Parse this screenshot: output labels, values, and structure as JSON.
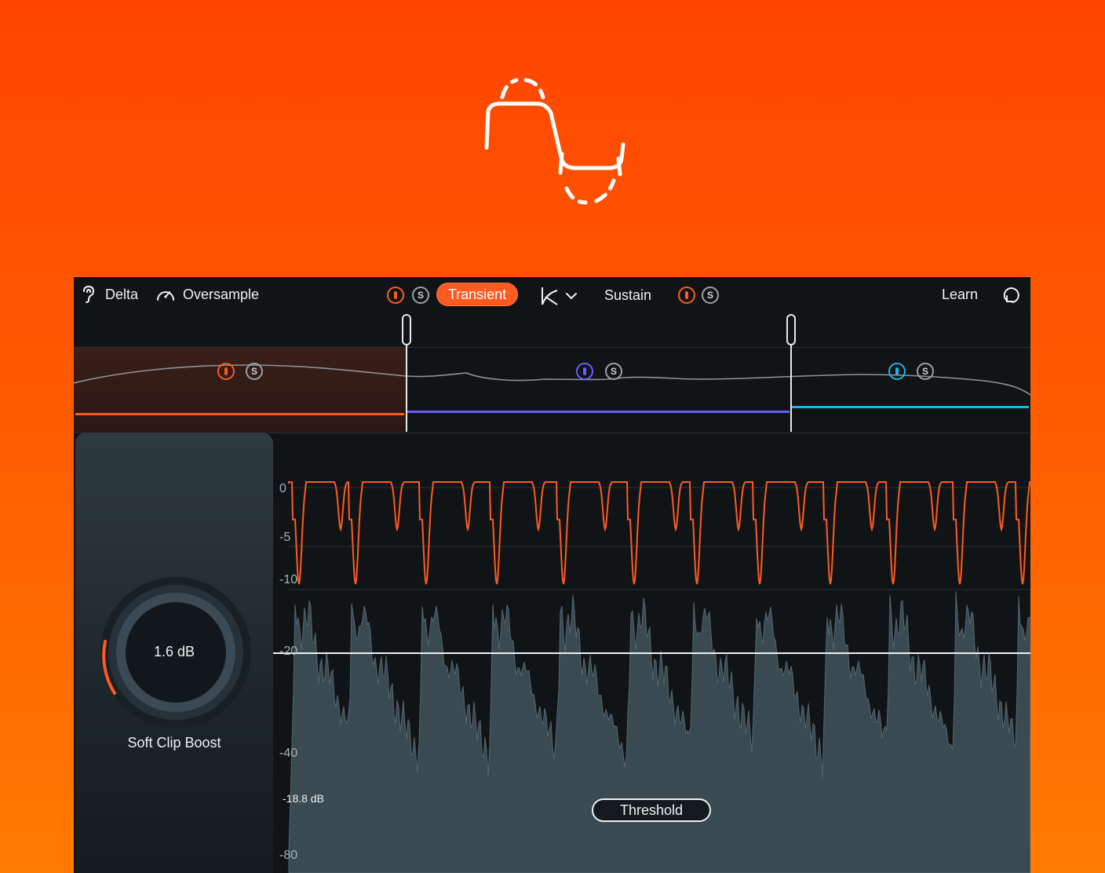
{
  "toolbar": {
    "delta_label": "Delta",
    "oversample_label": "Oversample",
    "transient_label": "Transient",
    "sustain_label": "Sustain",
    "learn_label": "Learn",
    "solo_glyph": "S"
  },
  "colors": {
    "accent": "#ff5a1f",
    "band_low": "#ff5a1f",
    "band_mid": "#6a5cff",
    "band_high": "#19b6e8",
    "background_top": "#ff4500",
    "background_bottom": "#ff7a00"
  },
  "icons": {
    "logo": "clipped-sine-icon",
    "delta": "ear-icon",
    "oversample": "gauge-icon",
    "knee": "knee-curve-icon",
    "dropdown": "chevron-down-icon",
    "history": "history-icon"
  },
  "knob": {
    "value_label": "1.6 dB",
    "label": "Soft Clip Boost"
  },
  "graph": {
    "y_labels": [
      "0",
      "-5",
      "-10",
      "-20",
      "-40",
      "-80"
    ],
    "threshold_value": "-18.8 dB",
    "threshold_label": "Threshold"
  }
}
